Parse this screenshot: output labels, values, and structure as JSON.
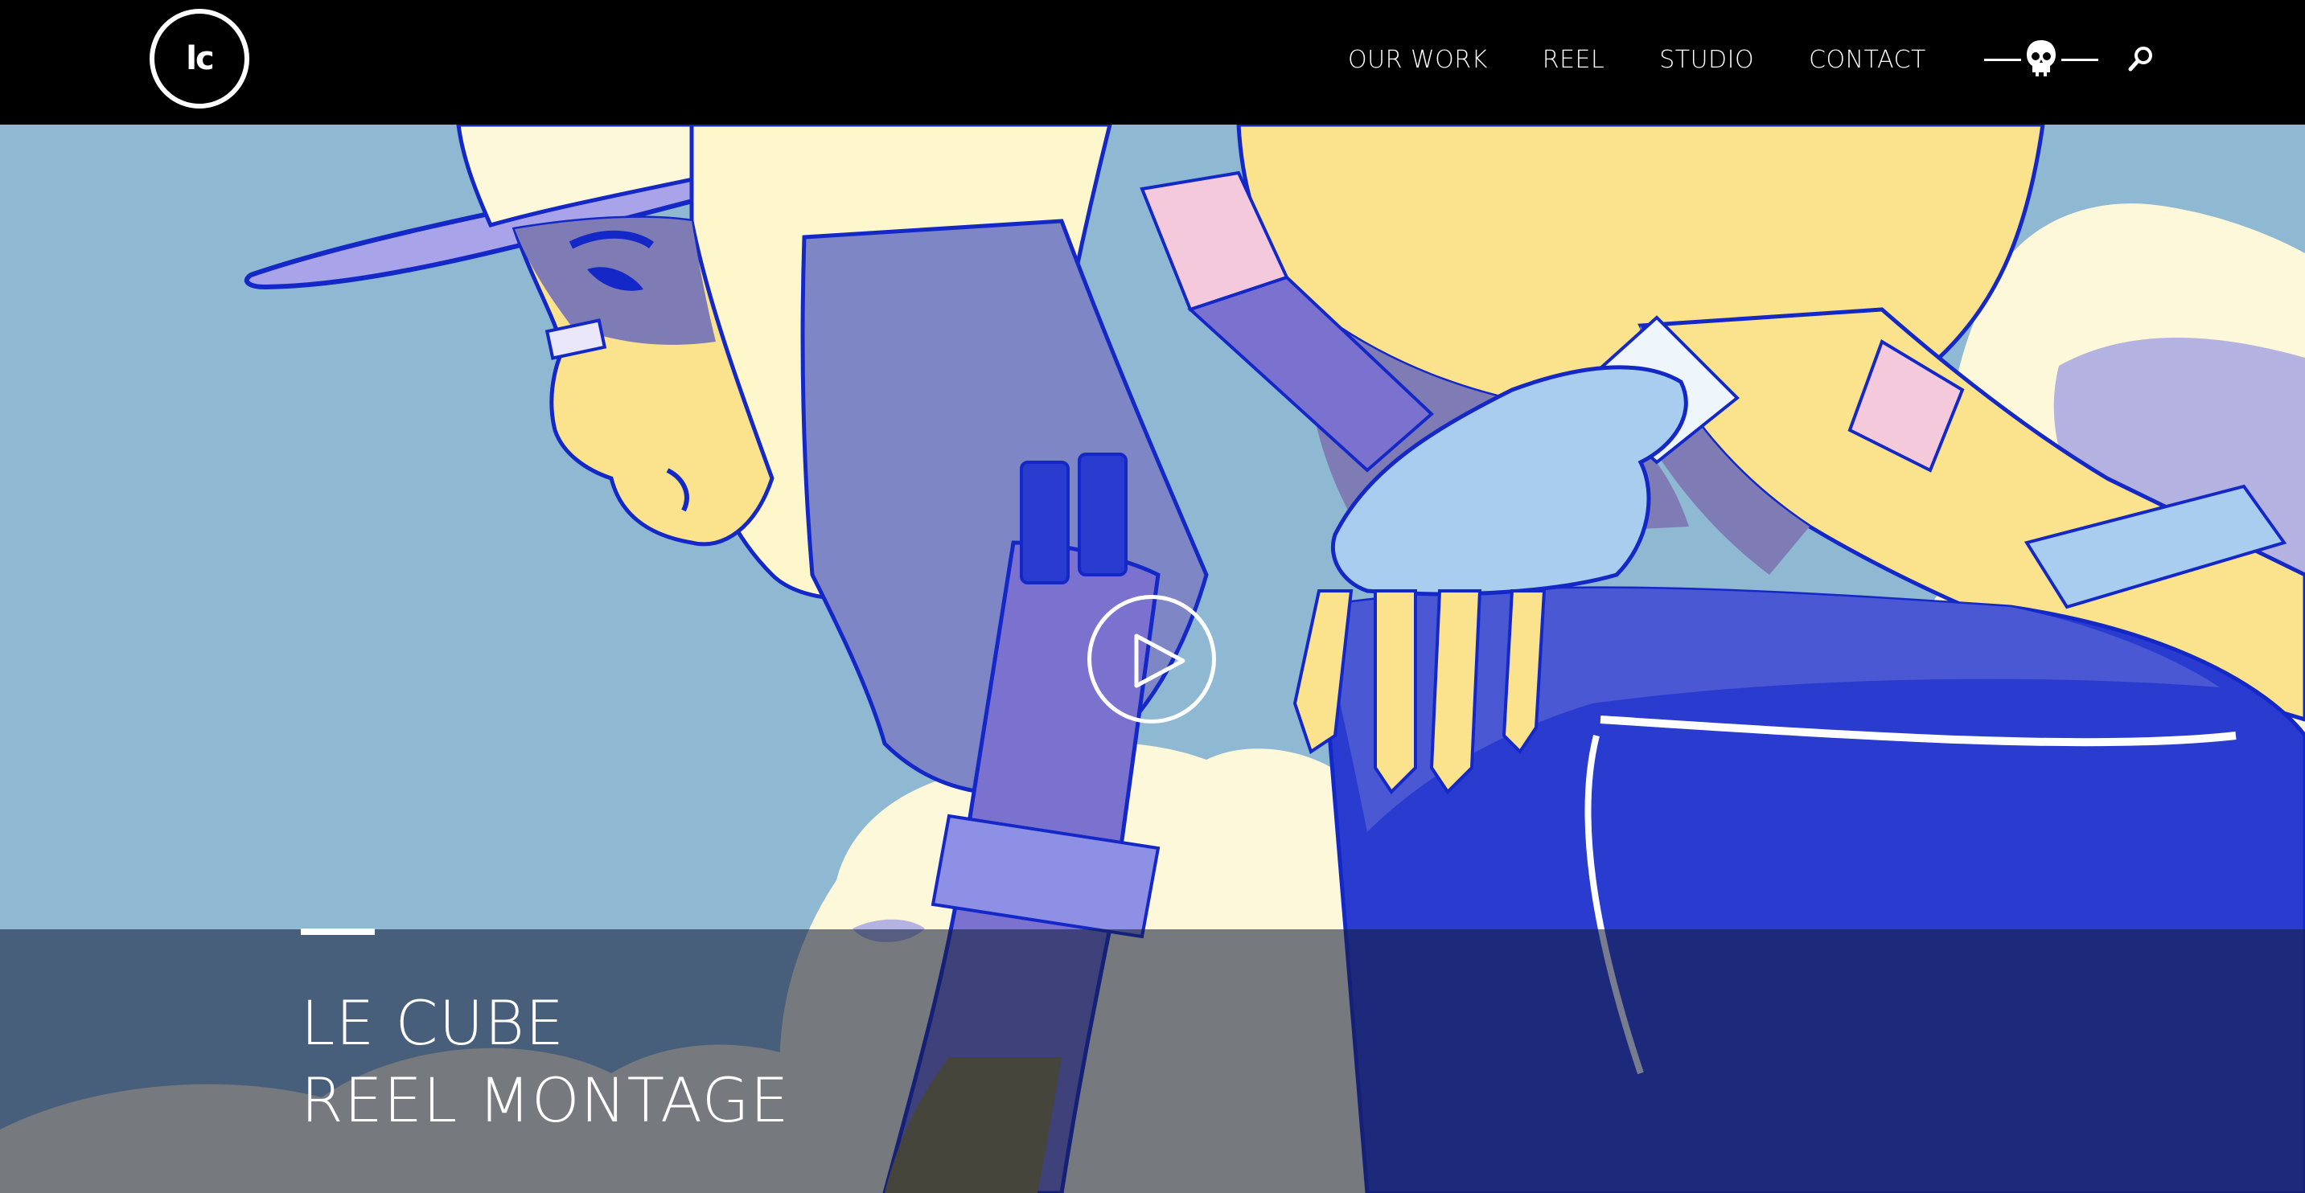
{
  "header": {
    "logo_text": "lc",
    "nav": [
      {
        "label": "OUR WORK"
      },
      {
        "label": "REEL"
      },
      {
        "label": "STUDIO"
      },
      {
        "label": "CONTACT"
      }
    ],
    "icons": {
      "skull": "skull-icon",
      "search": "search-icon"
    }
  },
  "hero": {
    "title_line1": "LE CUBE",
    "title_line2": "REEL MONTAGE",
    "play": "play-icon"
  },
  "colors": {
    "sky": "#8fb9d2",
    "cloud": "#fdf8d9",
    "cloud_shadow": "#b3b2e0",
    "yellow": "#fbe28c",
    "purple": "#7b72d0",
    "blue": "#2a3bd0",
    "ink": "#1428c8",
    "pink": "#f4c9dc",
    "light_blue": "#a8cdee"
  }
}
